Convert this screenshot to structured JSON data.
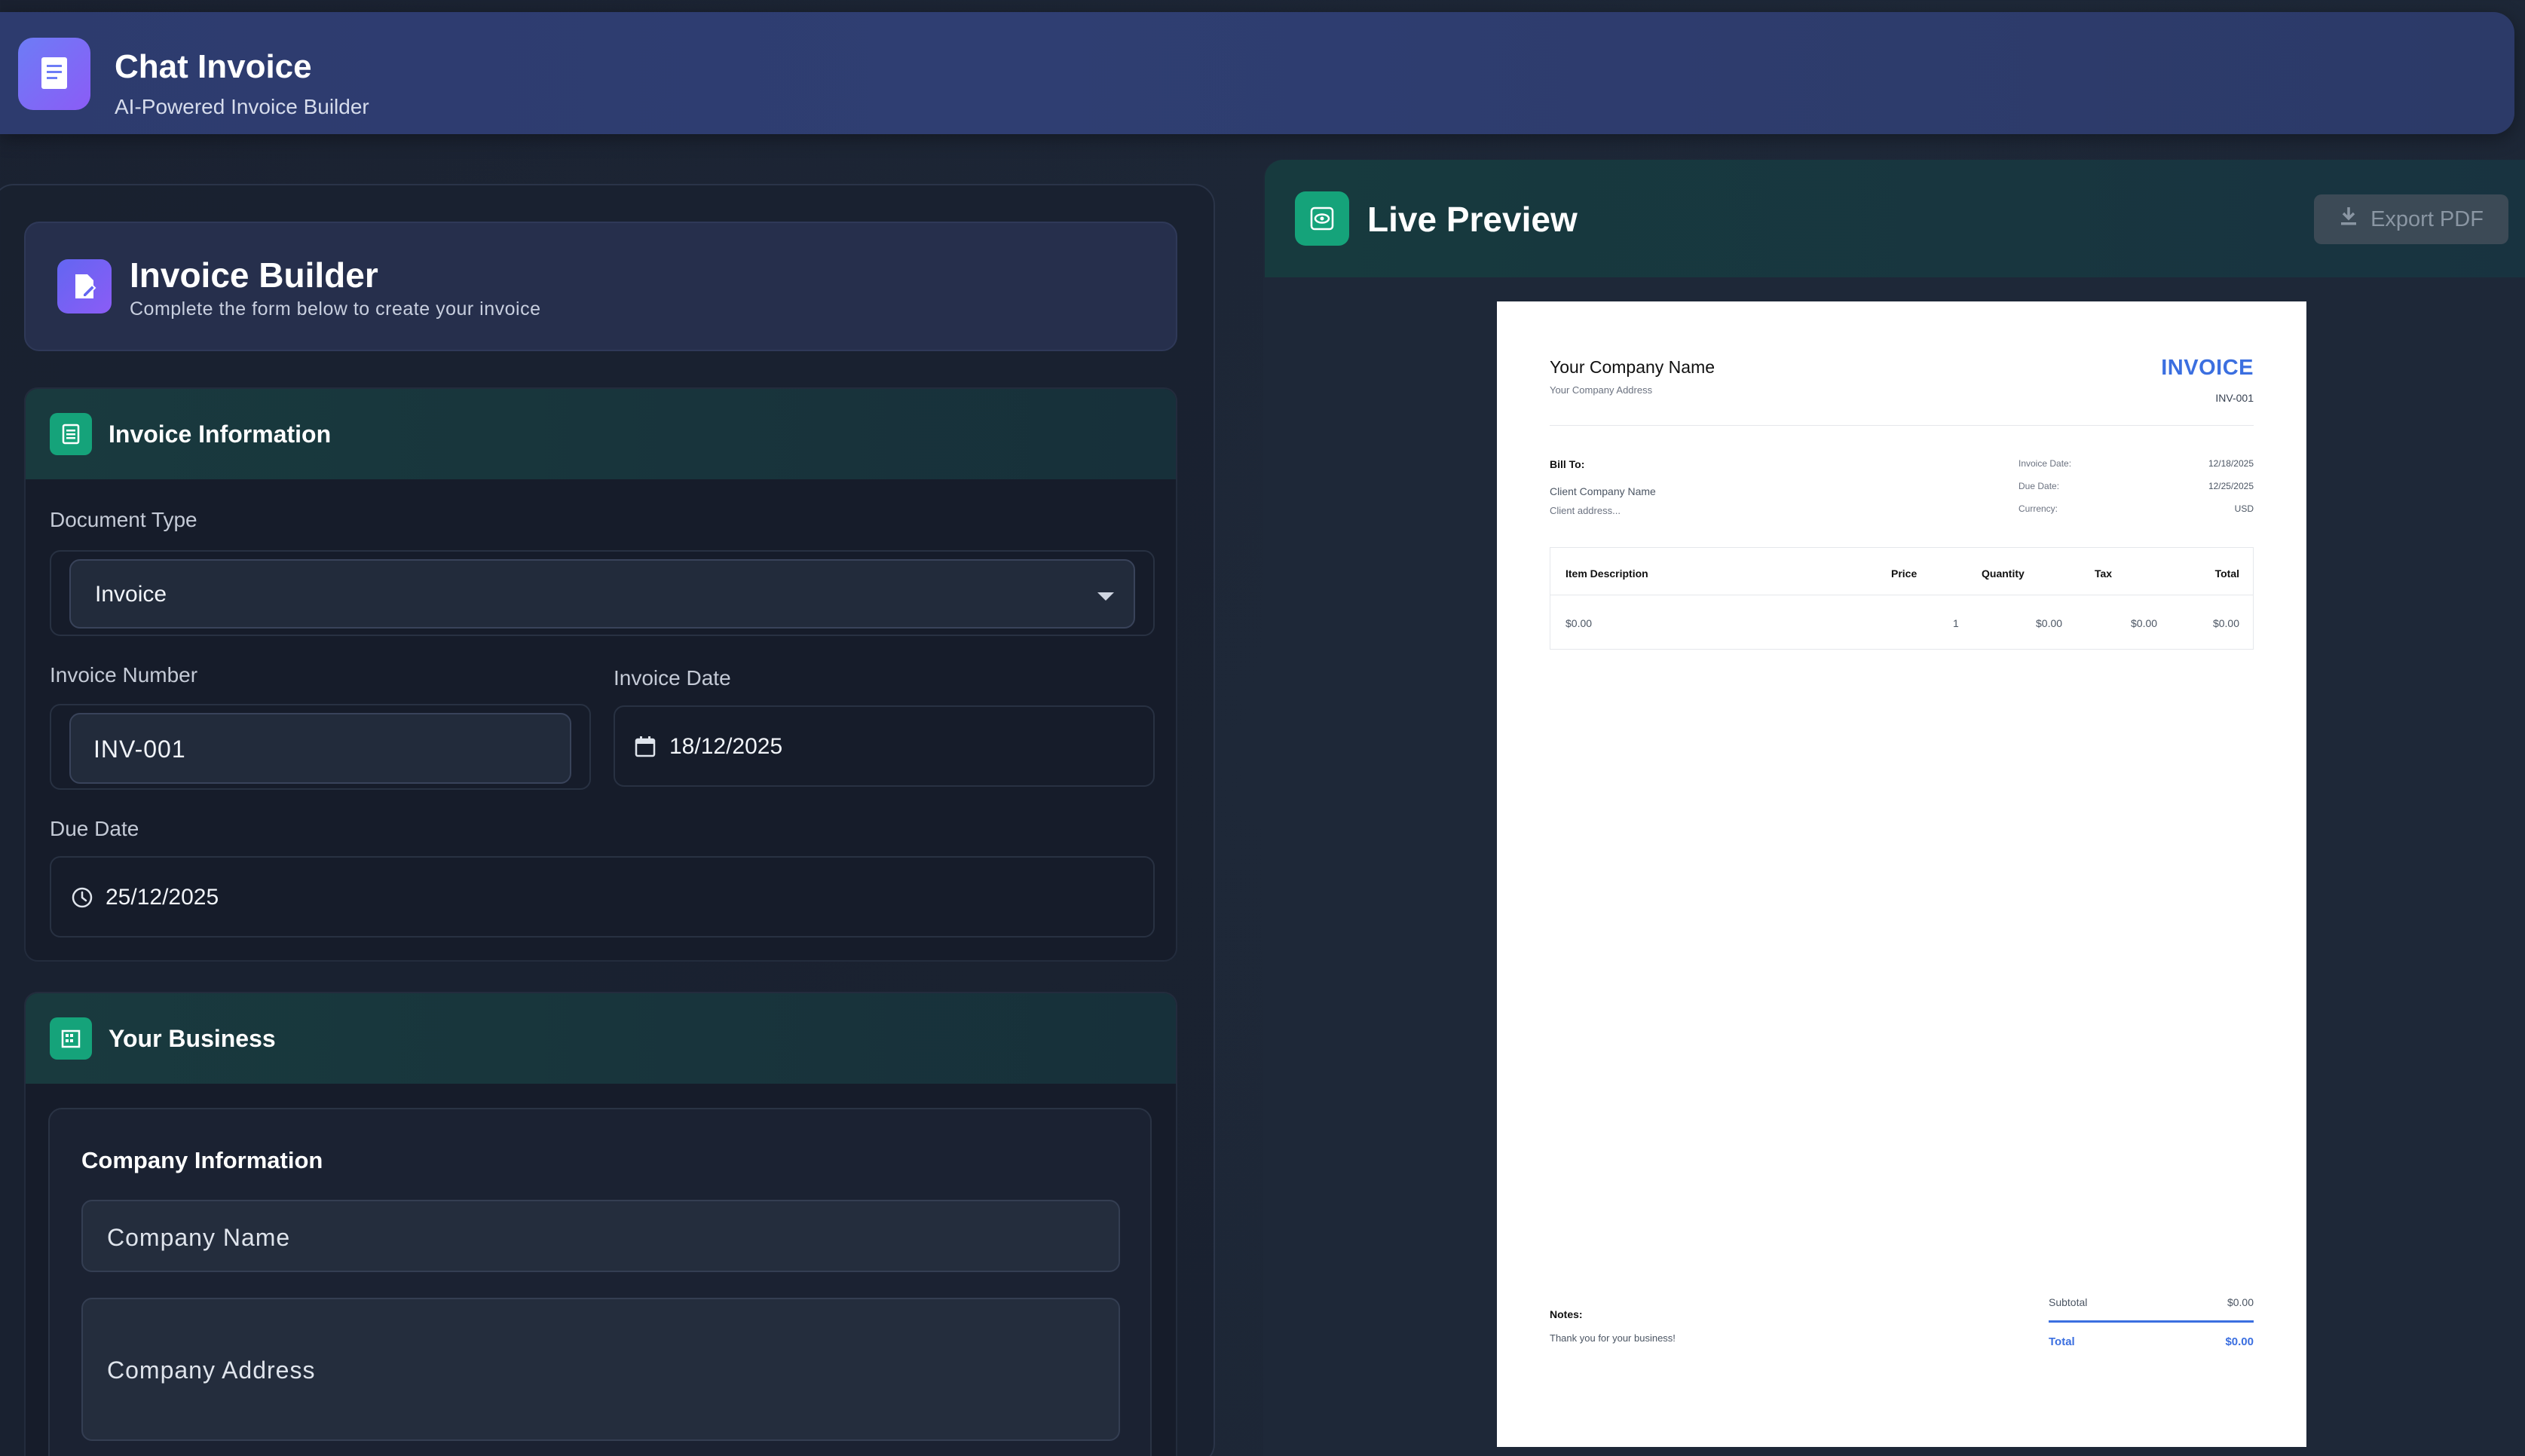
{
  "app": {
    "title": "Chat Invoice",
    "subtitle": "AI-Powered Invoice Builder",
    "logo_icon": "receipt-icon"
  },
  "builder": {
    "title": "Invoice Builder",
    "subtitle": "Complete the form below to create your invoice",
    "icon": "edit-document-icon"
  },
  "invoice_info": {
    "title": "Invoice Information",
    "icon": "document-lines-icon",
    "document_type_label": "Document Type",
    "document_type_value": "Invoice",
    "invoice_number_label": "Invoice Number",
    "invoice_number_value": "INV-001",
    "invoice_date_label": "Invoice Date",
    "invoice_date_value": "18/12/2025",
    "due_date_label": "Due Date",
    "due_date_value": "25/12/2025"
  },
  "business": {
    "title": "Your Business",
    "icon": "building-icon",
    "company_info_title": "Company Information",
    "company_name_placeholder": "Company Name",
    "company_address_placeholder": "Company Address"
  },
  "preview": {
    "title": "Live Preview",
    "icon": "eye-icon",
    "export_label": "Export PDF"
  },
  "paper": {
    "company_name": "Your Company Name",
    "company_address": "Your Company Address",
    "heading": "INVOICE",
    "number": "INV-001",
    "bill_to_label": "Bill To:",
    "client_name": "Client Company Name",
    "client_address": "Client address...",
    "meta": [
      {
        "label": "Invoice Date:",
        "value": "12/18/2025"
      },
      {
        "label": "Due Date:",
        "value": "12/25/2025"
      },
      {
        "label": "Currency:",
        "value": "USD"
      }
    ],
    "table": {
      "headers": [
        "Item Description",
        "Price",
        "Quantity",
        "Tax",
        "Total"
      ],
      "row": [
        "$0.00",
        "1",
        "$0.00",
        "$0.00",
        "$0.00"
      ]
    },
    "notes_label": "Notes:",
    "notes_text": "Thank you for your business!",
    "subtotal_label": "Subtotal",
    "subtotal_value": "$0.00",
    "total_label": "Total",
    "total_value": "$0.00",
    "accent_color": "#3b6fe0"
  },
  "colors": {
    "background": "#1e2838",
    "header": "#2f3e72",
    "section_accent": "#15a37a",
    "builder_accent": "#6366f1"
  }
}
